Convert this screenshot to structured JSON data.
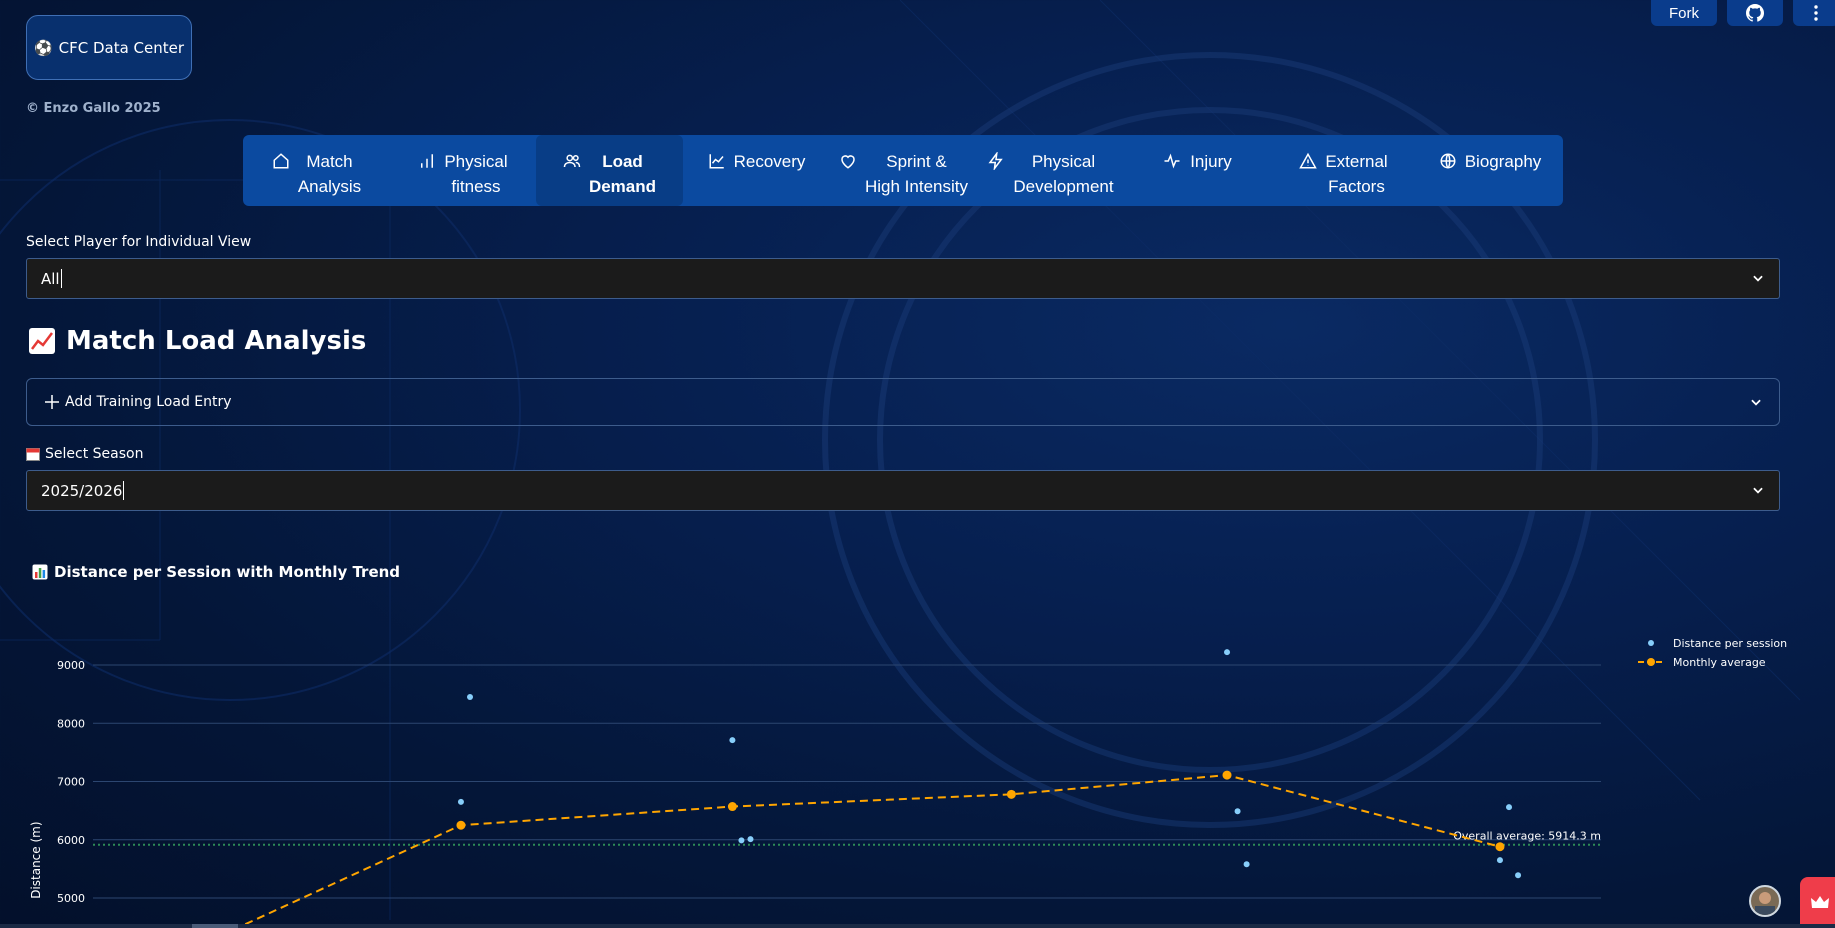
{
  "header": {
    "badge_icon": "soccer-ball-icon",
    "badge_label": "CFC Data Center",
    "copyright": "© Enzo Gallo 2025",
    "fork_label": "Fork"
  },
  "tabs": [
    {
      "line1": "Match",
      "line2": "Analysis",
      "icon": "home-icon",
      "active": false
    },
    {
      "line1": "Physical",
      "line2": "fitness",
      "icon": "bar-chart-icon",
      "active": false
    },
    {
      "line1": "Load",
      "line2": "Demand",
      "icon": "users-icon",
      "active": true
    },
    {
      "line1": "Recovery",
      "line2": "",
      "icon": "line-chart-icon",
      "active": false
    },
    {
      "line1": "Sprint &",
      "line2": "High Intensity",
      "icon": "heart-icon",
      "active": false
    },
    {
      "line1": "Physical",
      "line2": "Development",
      "icon": "lightning-icon",
      "active": false
    },
    {
      "line1": "Injury",
      "line2": "",
      "icon": "pulse-icon",
      "active": false
    },
    {
      "line1": "External",
      "line2": "Factors",
      "icon": "warning-icon",
      "active": false
    },
    {
      "line1": "Biography",
      "line2": "",
      "icon": "globe-icon",
      "active": false
    }
  ],
  "player_select": {
    "label": "Select Player for Individual View",
    "value": "All"
  },
  "section_title": "Match Load Analysis",
  "section_icon": "chart-increasing-icon",
  "expander_label": "Add Training Load Entry",
  "season_select": {
    "label": "Select Season",
    "value": "2025/2026",
    "icon": "calendar-icon"
  },
  "chart_header": {
    "title": "Distance per Session with Monthly Trend",
    "icon": "bar-chart-emoji-icon"
  },
  "colors": {
    "accent": "#0b4aa0",
    "scatter": "#87cefa",
    "trend": "#ffa500",
    "average_line": "#2e8b57"
  },
  "chart_data": {
    "type": "scatter",
    "ylabel": "Distance (m)",
    "xlabel": "",
    "y_ticks": [
      5000,
      6000,
      7000,
      8000,
      9000
    ],
    "ylim": [
      4750,
      9500
    ],
    "xlim": [
      0,
      100
    ],
    "grid": true,
    "legend": "top-right",
    "series": [
      {
        "name": "Distance per session",
        "kind": "scatter",
        "points": [
          [
            24.4,
            6650
          ],
          [
            25.0,
            8450
          ],
          [
            42.4,
            7710
          ],
          [
            43.0,
            5990
          ],
          [
            43.6,
            6010
          ],
          [
            75.2,
            9220
          ],
          [
            75.9,
            6490
          ],
          [
            76.5,
            5580
          ],
          [
            93.3,
            5650
          ],
          [
            93.9,
            6560
          ],
          [
            94.5,
            5390
          ]
        ]
      },
      {
        "name": "Monthly average",
        "kind": "line",
        "points": [
          [
            10.1,
            4550
          ],
          [
            24.4,
            6250
          ],
          [
            42.4,
            6570
          ],
          [
            60.9,
            6780
          ],
          [
            75.2,
            7110
          ],
          [
            93.3,
            5880
          ]
        ]
      }
    ],
    "reference_line": {
      "y": 5914.3,
      "label": "Overall average: 5914.3 m"
    }
  }
}
